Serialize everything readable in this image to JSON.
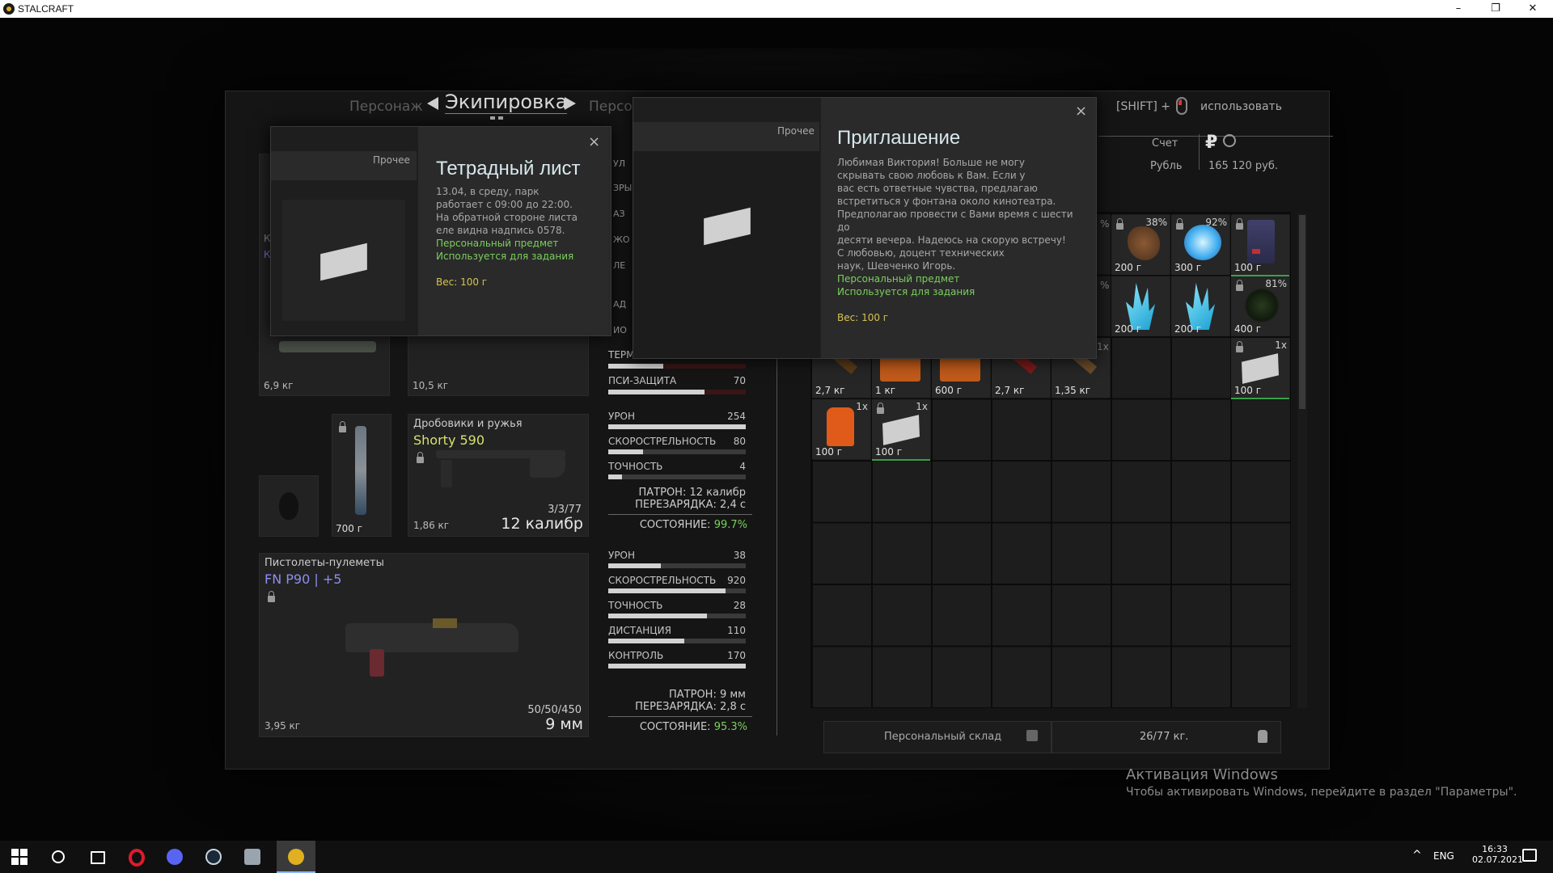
{
  "window": {
    "title": "STALCRAFT",
    "minimize": "–",
    "restore": "❐",
    "close": "✕"
  },
  "nav": {
    "left_tab": "Персонаж",
    "active_tab": "Экипировка",
    "right_tab": "Персо",
    "hint_shift": "[SHIFT] +",
    "hint_use": "использовать"
  },
  "account": {
    "label": "Счет",
    "currency": "Рубль",
    "balance": "165 120 руб.",
    "ruble_symbol": "₽"
  },
  "equipment": {
    "armor_weight": "6,9 кг",
    "helmet_weight": "10,5 кг",
    "armor_label_k1": "К",
    "armor_label_k2": "К",
    "terminal_label": "ТЕРМ",
    "psi_label": "ПСИ-ЗАЩИТА",
    "psi_value": "70",
    "psi_pct": 0.7,
    "side_labels": [
      "УЛ",
      "ЗРЫ",
      "АЗ",
      "ЖО",
      "ЛЕ",
      "АД",
      "ИО"
    ],
    "knife_weight": "700 г",
    "shotgun": {
      "category": "Дробовики и ружья",
      "name": "Shorty 590",
      "weight": "1,86 кг",
      "ammo_count": "3/3/77",
      "caliber": "12 калибр",
      "stats": [
        {
          "label": "УРОН",
          "value": "254",
          "pct": 1.0
        },
        {
          "label": "СКОРОСТРЕЛЬНОСТЬ",
          "value": "80",
          "pct": 0.25
        },
        {
          "label": "ТОЧНОСТЬ",
          "value": "4",
          "pct": 0.1
        }
      ],
      "ammo_line": "ПАТРОН: 12 калибр",
      "reload_line": "ПЕРЕЗАРЯДКА: 2,4 с",
      "condition_label": "СОСТОЯНИЕ:",
      "condition_value": "99.7%"
    },
    "smg": {
      "category": "Пистолеты-пулеметы",
      "name": "FN P90 | +5",
      "weight": "3,95 кг",
      "ammo_count": "50/50/450",
      "caliber": "9 мм",
      "stats": [
        {
          "label": "УРОН",
          "value": "38",
          "pct": 0.38
        },
        {
          "label": "СКОРОСТРЕЛЬНОСТЬ",
          "value": "920",
          "pct": 0.85
        },
        {
          "label": "ТОЧНОСТЬ",
          "value": "28",
          "pct": 0.72
        },
        {
          "label": "ДИСТАНЦИЯ",
          "value": "110",
          "pct": 0.55
        },
        {
          "label": "КОНТРОЛЬ",
          "value": "170",
          "pct": 1.0
        }
      ],
      "ammo_line": "ПАТРОН: 9 мм",
      "reload_line": "ПЕРЕЗАРЯДКА: 2,8 с",
      "condition_label": "СОСТОЯНИЕ:",
      "condition_value": "95.3%"
    }
  },
  "tooltip_left": {
    "category": "Прочее",
    "title": "Тетрадный лист",
    "lines": [
      "13.04, в среду, парк",
      "работает с 09:00 до 22:00.",
      "На обратной стороне листа",
      "еле видна надпись 0578."
    ],
    "tag1": "Персональный предмет",
    "tag2": "Используется для задания",
    "weight": "Вес: 100 г",
    "close": "×"
  },
  "tooltip_right": {
    "category": "Прочее",
    "title": "Приглашение",
    "lines": [
      "Любимая Виктория! Больше не могу",
      "скрывать свою любовь к Вам. Если у",
      "вас есть ответные чувства, предлагаю",
      "встретиться у фонтана около кинотеатра.",
      "Предполагаю провести с Вами время с шести до",
      "десяти вечера. Надеюсь на скорую встречу!",
      "С любовью, доцент технических",
      "наук, Шевченко Игорь."
    ],
    "tag1": "Персональный предмет",
    "tag2": "Используется для задания",
    "weight": "Вес: 100 г",
    "close": "×"
  },
  "inventory": {
    "row1": [
      {
        "pct": "38%",
        "weight": "200 г"
      },
      {
        "pct": "92%",
        "weight": "300 г"
      },
      {
        "pct": "",
        "weight": "100 г"
      }
    ],
    "row2": [
      {
        "pct": "",
        "weight": "200 г"
      },
      {
        "pct": "",
        "weight": "200 г"
      },
      {
        "pct": "81%",
        "weight": "400 г"
      }
    ],
    "row3": [
      {
        "weight": "2,7 кг"
      },
      {
        "weight": "1 кг"
      },
      {
        "weight": "600 г"
      },
      {
        "weight": "2,7 кг"
      },
      {
        "weight": "1,35 кг"
      },
      {
        "weight": "100 г",
        "count": "1x"
      }
    ],
    "row4": [
      {
        "weight": "100 г",
        "count": "1x"
      },
      {
        "weight": "100 г",
        "count": "1x"
      }
    ],
    "partial_pct_a": "%",
    "partial_pct_b": "%",
    "partial_count": "1x",
    "storage_label": "Персональный склад",
    "capacity": "26/77 кг."
  },
  "windows_activation": {
    "title": "Активация Windows",
    "subtitle": "Чтобы активировать Windows, перейдите в раздел \"Параметры\"."
  },
  "taskbar": {
    "lang": "ENG",
    "time": "16:33",
    "date": "02.07.2021",
    "tray_arrow": "^"
  }
}
